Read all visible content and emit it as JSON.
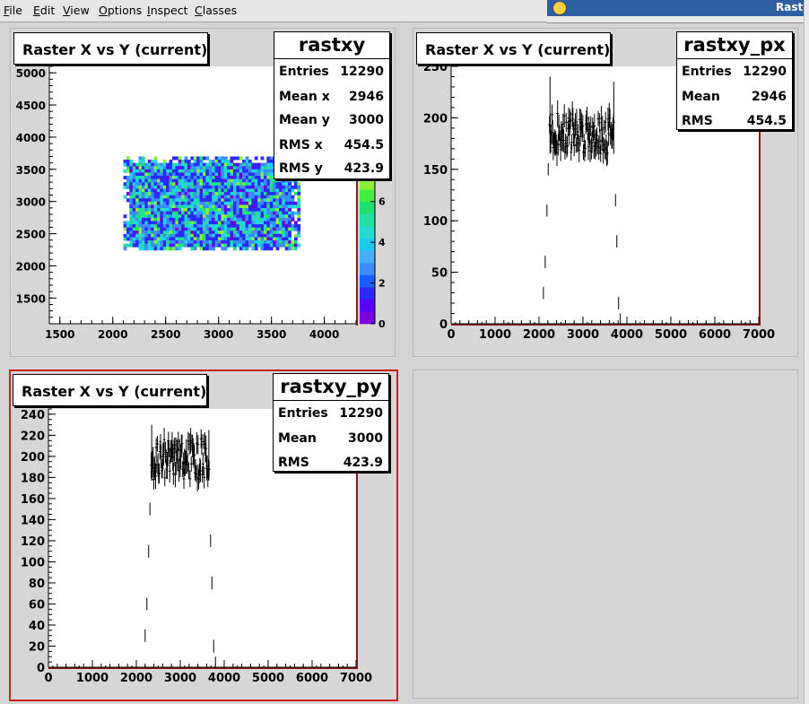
{
  "menubar": {
    "items": [
      {
        "label": "File",
        "u": "F",
        "rest": "ile"
      },
      {
        "label": "Edit",
        "u": "E",
        "rest": "dit"
      },
      {
        "label": "View",
        "u": "V",
        "rest": "iew"
      },
      {
        "label": "Options",
        "u": "O",
        "rest": "ptions"
      },
      {
        "label": "Inspect",
        "u": "I",
        "rest": "nspect"
      },
      {
        "label": "Classes",
        "u": "C",
        "rest": "lasses"
      }
    ]
  },
  "other_window": {
    "title": "Raster"
  },
  "pads": {
    "pad1": {
      "title": "Raster X vs Y (current)",
      "stats": {
        "name": "rastxy",
        "rows": [
          {
            "k": "Entries",
            "v": "12290"
          },
          {
            "k": "Mean x",
            "v": "2946"
          },
          {
            "k": "Mean y",
            "v": "3000"
          },
          {
            "k": "RMS x",
            "v": "454.5"
          },
          {
            "k": "RMS y",
            "v": "423.9"
          }
        ]
      },
      "x_ticks": [
        "1500",
        "2000",
        "2500",
        "3000",
        "3500",
        "4000"
      ],
      "y_ticks": [
        "1500",
        "2000",
        "2500",
        "3000",
        "3500",
        "4000",
        "4500",
        "5000"
      ],
      "z_ticks": [
        "0",
        "2",
        "4",
        "6"
      ]
    },
    "pad2": {
      "title": "Raster X vs Y (current)",
      "stats": {
        "name": "rastxy_px",
        "rows": [
          {
            "k": "Entries",
            "v": "12290"
          },
          {
            "k": "Mean",
            "v": "2946"
          },
          {
            "k": "RMS",
            "v": "454.5"
          }
        ]
      },
      "x_ticks": [
        "0",
        "1000",
        "2000",
        "3000",
        "4000",
        "5000",
        "6000",
        "7000"
      ],
      "y_ticks": [
        "0",
        "50",
        "100",
        "150",
        "200",
        "250"
      ]
    },
    "pad3": {
      "title": "Raster X vs Y (current)",
      "stats": {
        "name": "rastxy_py",
        "rows": [
          {
            "k": "Entries",
            "v": "12290"
          },
          {
            "k": "Mean",
            "v": "3000"
          },
          {
            "k": "RMS",
            "v": "423.9"
          }
        ]
      },
      "x_ticks": [
        "0",
        "1000",
        "2000",
        "3000",
        "4000",
        "5000",
        "6000",
        "7000"
      ],
      "y_ticks": [
        "0",
        "20",
        "40",
        "60",
        "80",
        "100",
        "120",
        "140",
        "160",
        "180",
        "200",
        "220",
        "240"
      ]
    }
  },
  "chart_data": [
    {
      "type": "heatmap",
      "title": "Raster X vs Y (current)",
      "xlim": [
        1400,
        4300
      ],
      "ylim": [
        1100,
        5100
      ],
      "filled_region": {
        "x": [
          2100,
          3750
        ],
        "y": [
          2250,
          3700
        ]
      },
      "z_range": [
        0,
        7
      ],
      "colors": [
        "#6b00d6",
        "#2a2aff",
        "#3a8cff",
        "#22d6e6",
        "#22e08a",
        "#8af03a"
      ]
    },
    {
      "type": "bar",
      "title": "Raster X vs Y (current)",
      "xlim": [
        0,
        7000
      ],
      "ylim": [
        0,
        250
      ],
      "series": [
        {
          "name": "rastxy_px",
          "x_range": [
            2200,
            3750
          ],
          "plateau": 185,
          "max": 240
        }
      ]
    },
    {
      "type": "bar",
      "title": "Raster X vs Y (current)",
      "xlim": [
        0,
        7000
      ],
      "ylim": [
        0,
        245
      ],
      "series": [
        {
          "name": "rastxy_py",
          "x_range": [
            2300,
            3700
          ],
          "plateau": 197,
          "max": 230
        }
      ]
    }
  ]
}
